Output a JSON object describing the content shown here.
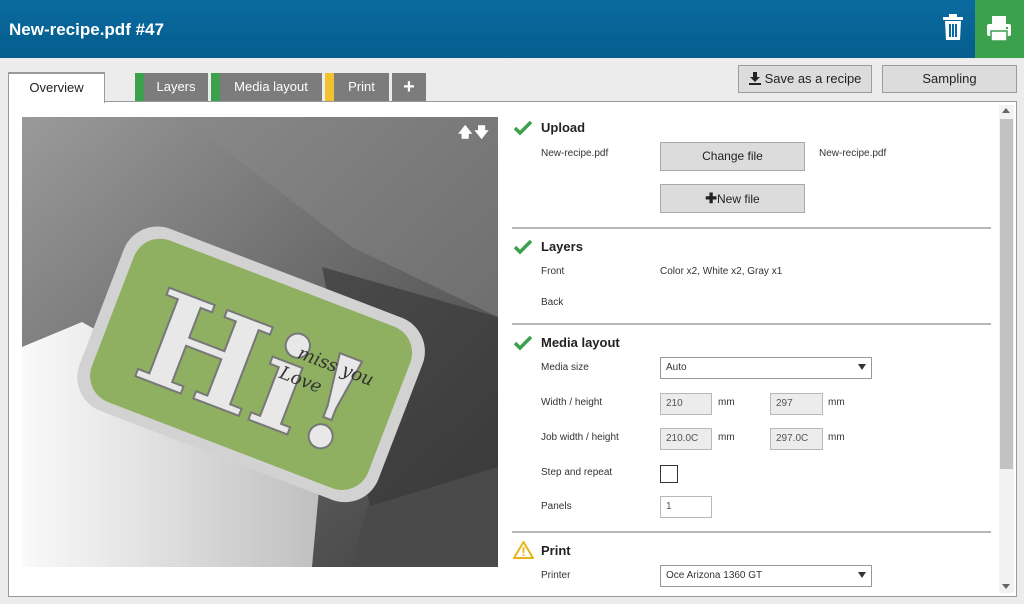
{
  "header": {
    "title": "New-recipe.pdf #47",
    "delete_icon": "trash-icon",
    "print_icon": "printer-icon"
  },
  "tabs": [
    {
      "label": "Overview",
      "stripe": ""
    },
    {
      "label": "Layers",
      "stripe": "#3ca14c"
    },
    {
      "label": "Media layout",
      "stripe": "#3ca14c"
    },
    {
      "label": "Print",
      "stripe": "#f2c12e"
    },
    {
      "label": "+",
      "stripe": ""
    }
  ],
  "actions": {
    "save_recipe": "Save as a recipe",
    "save_icon": "download-icon",
    "sampling": "Sampling"
  },
  "preview": {
    "image_text": "Hi!",
    "handwriting": "miss you / Love"
  },
  "upload": {
    "title": "Upload",
    "file_label": "New-recipe.pdf",
    "change_button": "Change file",
    "current_file": "New-recipe.pdf",
    "new_file_button": "New file"
  },
  "layers": {
    "title": "Layers",
    "front_label": "Front",
    "front_value": "Color x2, White x2, Gray x1",
    "back_label": "Back"
  },
  "media_layout": {
    "title": "Media layout",
    "media_size_label": "Media size",
    "media_size_value": "Auto",
    "wh_label": "Width / height",
    "width": "210",
    "height": "297",
    "unit": "mm",
    "job_wh_label": "Job width / height",
    "job_width": "210.0C",
    "job_height": "297.0C",
    "step_label": "Step and repeat",
    "step_checked": false,
    "panels_label": "Panels",
    "panels_value": "1"
  },
  "print": {
    "title": "Print",
    "printer_label": "Printer",
    "printer_value": "Oce Arizona 1360 GT"
  },
  "colors": {
    "header": "#055d8d",
    "green": "#3ca14c",
    "yellow": "#f2c12e"
  }
}
